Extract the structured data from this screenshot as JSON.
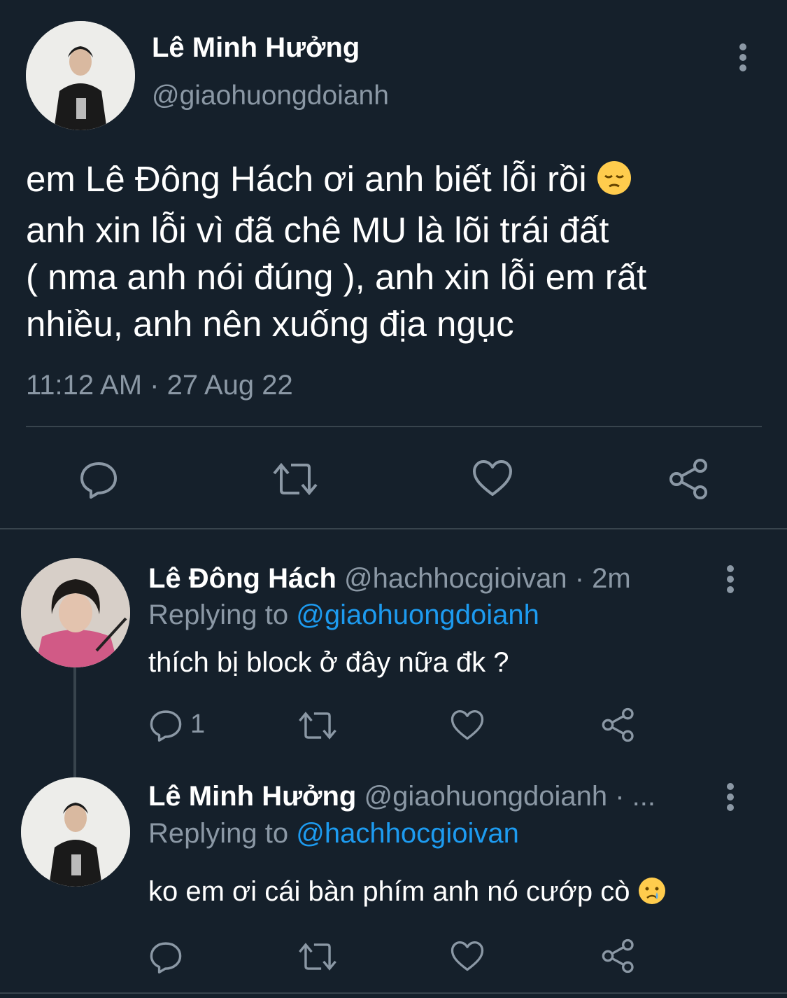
{
  "main_tweet": {
    "author_name": "Lê Minh Hưởng",
    "author_handle": "@giaohuongdoianh",
    "text_lines": [
      "em Lê Đông Hách ơi anh biết lỗi rồi",
      "anh xin lỗi vì đã chê MU là lõi trái đất",
      "( nma anh nói đúng ), anh xin lỗi em rất",
      "nhiều, anh nên xuống địa ngục"
    ],
    "emoji": "pensive-face",
    "timestamp": "11:12 AM · 27 Aug 22"
  },
  "replies": [
    {
      "author_name": "Lê Đông Hách",
      "meta": "@hachhocgioivan · 2m",
      "replying_prefix": "Replying to ",
      "replying_to": "@giaohuongdoianh",
      "text": "thích bị block ở đây nữa đk ?",
      "reply_count": "1"
    },
    {
      "author_name": "Lê Minh Hưởng",
      "meta": "@giaohuongdoianh · ...",
      "replying_prefix": "Replying to ",
      "replying_to": "@hachhocgioivan",
      "text": "ko em ơi cái bàn phím anh nó cướp cò",
      "emoji": "crying-face"
    }
  ],
  "colors": {
    "background": "#15202b",
    "text": "#ffffff",
    "muted": "#8b98a5",
    "link": "#1d9bf0",
    "divider": "#38444d"
  }
}
